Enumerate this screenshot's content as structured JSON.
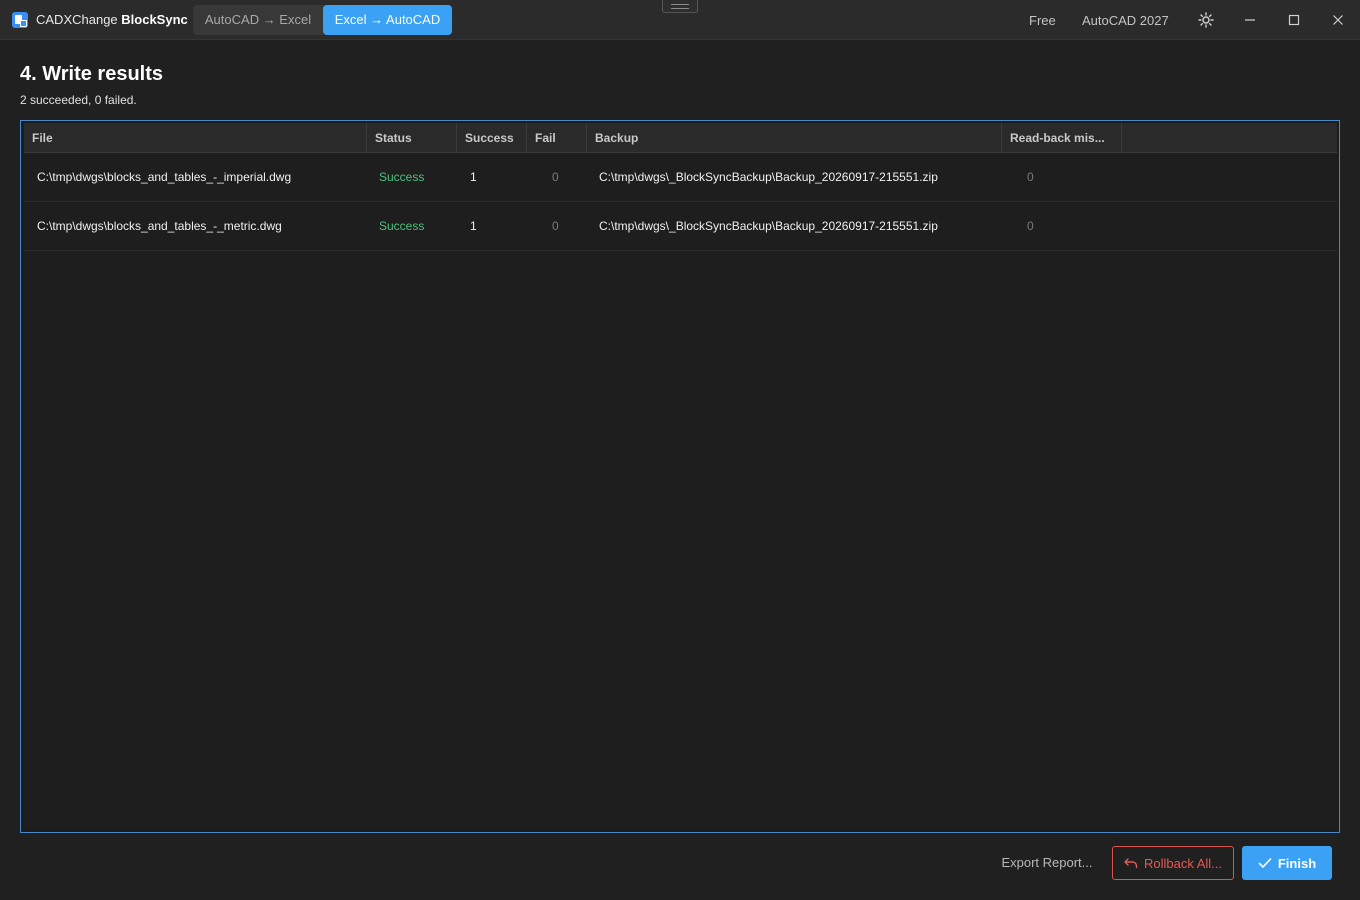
{
  "app": {
    "brand_prefix": "CADXChange",
    "brand_name": "BlockSync"
  },
  "mode_tabs": [
    {
      "label": "AutoCAD → Excel",
      "active": false
    },
    {
      "label": "Excel → AutoCAD",
      "active": true
    }
  ],
  "titlebar": {
    "license": "Free",
    "cad_version": "AutoCAD 2027",
    "theme_icon": "sun-icon",
    "minimize_icon": "minimize-icon",
    "maximize_icon": "maximize-icon",
    "close_icon": "close-icon"
  },
  "page": {
    "title": "4. Write results",
    "summary": "2 succeeded, 0 failed."
  },
  "table": {
    "columns": [
      "File",
      "Status",
      "Success",
      "Fail",
      "Backup",
      "Read-back mis..."
    ],
    "rows": [
      {
        "file": "C:\\tmp\\dwgs\\blocks_and_tables_-_imperial.dwg",
        "status": "Success",
        "success": "1",
        "fail": "0",
        "backup": "C:\\tmp\\dwgs\\_BlockSyncBackup\\Backup_20260917-215551.zip",
        "readback": "0"
      },
      {
        "file": "C:\\tmp\\dwgs\\blocks_and_tables_-_metric.dwg",
        "status": "Success",
        "success": "1",
        "fail": "0",
        "backup": "C:\\tmp\\dwgs\\_BlockSyncBackup\\Backup_20260917-215551.zip",
        "readback": "0"
      }
    ]
  },
  "actions": {
    "export_label": "Export Report...",
    "rollback_label": "Rollback All...",
    "finish_label": "Finish"
  },
  "colors": {
    "accent": "#3ba1f5",
    "success": "#4bc27b",
    "danger": "#e25a55",
    "background": "#202020"
  }
}
